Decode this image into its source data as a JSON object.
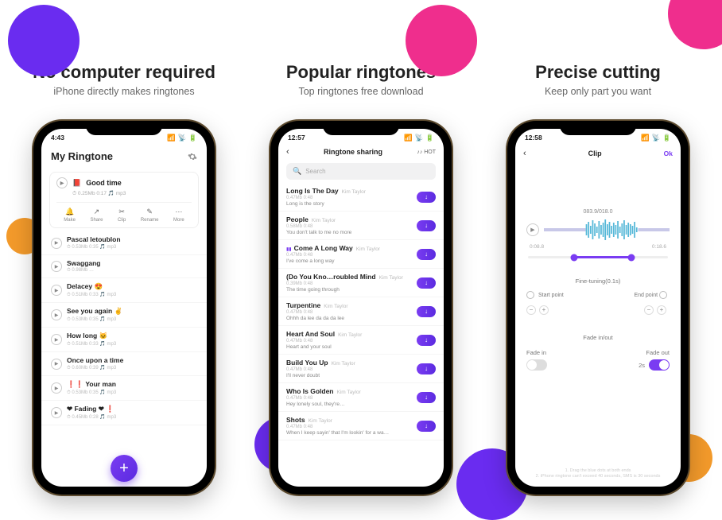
{
  "panel1": {
    "headline": "No computer required",
    "subhead": "iPhone directly makes ringtones",
    "status_time": "4:43",
    "title": "My Ringtone",
    "featured": {
      "title": "Good time",
      "meta": "⏱ 0.25Mb   0:17   🎵 mp3"
    },
    "actions": [
      {
        "icon": "🔔",
        "label": "Make"
      },
      {
        "icon": "↗",
        "label": "Share"
      },
      {
        "icon": "✂",
        "label": "Clip"
      },
      {
        "icon": "✎",
        "label": "Rename"
      },
      {
        "icon": "⋯",
        "label": "More"
      }
    ],
    "items": [
      {
        "title": "Pascal letoublon",
        "meta": "⏱ 0.53Mb   0:35   🎵 mp3"
      },
      {
        "title": "Swaggang",
        "meta": "⏱ 0.98Mb   …"
      },
      {
        "title": "Delacey 😍",
        "meta": "⏱ 0.51Mb   0:33   🎵 mp3"
      },
      {
        "title": "See you again ✌",
        "meta": "⏱ 0.53Mb   0:35   🎵 mp3"
      },
      {
        "title": "How long 🐱",
        "meta": "⏱ 0.51Mb   0:33   🎵 mp3"
      },
      {
        "title": "Once upon a time",
        "meta": "⏱ 0.60Mb   0:39   🎵 mp3"
      },
      {
        "title": "❗❗ Your man",
        "meta": "⏱ 0.53Mb   0:35   🎵 mp3"
      },
      {
        "title": "❤ Fading ❤ ❗",
        "meta": "⏱ 0.45Mb   0:28   🎵 mp3"
      }
    ]
  },
  "panel2": {
    "headline": "Popular ringtones",
    "subhead": "Top ringtones free download",
    "status_time": "12:57",
    "nav_title": "Ringtone sharing",
    "hot_label": "♪♪ HOT",
    "search_placeholder": "Search",
    "songs": [
      {
        "title": "Long Is The Day",
        "artist": "Kim Taylor",
        "meta": "0.47Mb   0:48",
        "caption": "Long is the story"
      },
      {
        "title": "People",
        "artist": "Kim Taylor",
        "meta": "0.58Mb   0:48",
        "caption": "You don't talk to me no more"
      },
      {
        "title": "Come A Long Way",
        "artist": "Kim Taylor",
        "meta": "0.47Mb   0:48",
        "caption": "I've come a long way",
        "playing": true
      },
      {
        "title": "(Do You Kno…roubled Mind",
        "artist": "Kim Taylor",
        "meta": "0.39Mb   0:48",
        "caption": "The time going through"
      },
      {
        "title": "Turpentine",
        "artist": "Kim Taylor",
        "meta": "0.47Mb   0:48",
        "caption": "Ohhh da lee da da da lee"
      },
      {
        "title": "Heart And Soul",
        "artist": "Kim Taylor",
        "meta": "0.47Mb   0:48",
        "caption": "Heart and your soul"
      },
      {
        "title": "Build You Up",
        "artist": "Kim Taylor",
        "meta": "0.47Mb   0:48",
        "caption": "I'll never doubt"
      },
      {
        "title": "Who Is Golden",
        "artist": "Kim Taylor",
        "meta": "0.47Mb   0:48",
        "caption": "Hey lonely soul, they're…"
      },
      {
        "title": "Shots",
        "artist": "Kim Taylor",
        "meta": "0.47Mb   0:48",
        "caption": "When I keep sayin' that I'm lookin' for a wa…"
      }
    ]
  },
  "panel3": {
    "headline": "Precise cutting",
    "subhead": "Keep only part you want",
    "status_time": "12:58",
    "nav_title": "Clip",
    "ok_label": "Ok",
    "time_position": "083.9/018.0",
    "range_start": "0:08.8",
    "range_end": "0:18.6",
    "fine_tune_label": "Fine-tuning(0.1s)",
    "start_label": "Start point",
    "end_label": "End point",
    "fade_section": "Fade in/out",
    "fade_in_label": "Fade in",
    "fade_out_label": "Fade out",
    "fade_out_value": "2s",
    "hint1": "1. Drag the blue dots at both ends",
    "hint2": "2. iPhone ringtone can't exceed 40 seconds, SMS is 30 seconds"
  }
}
